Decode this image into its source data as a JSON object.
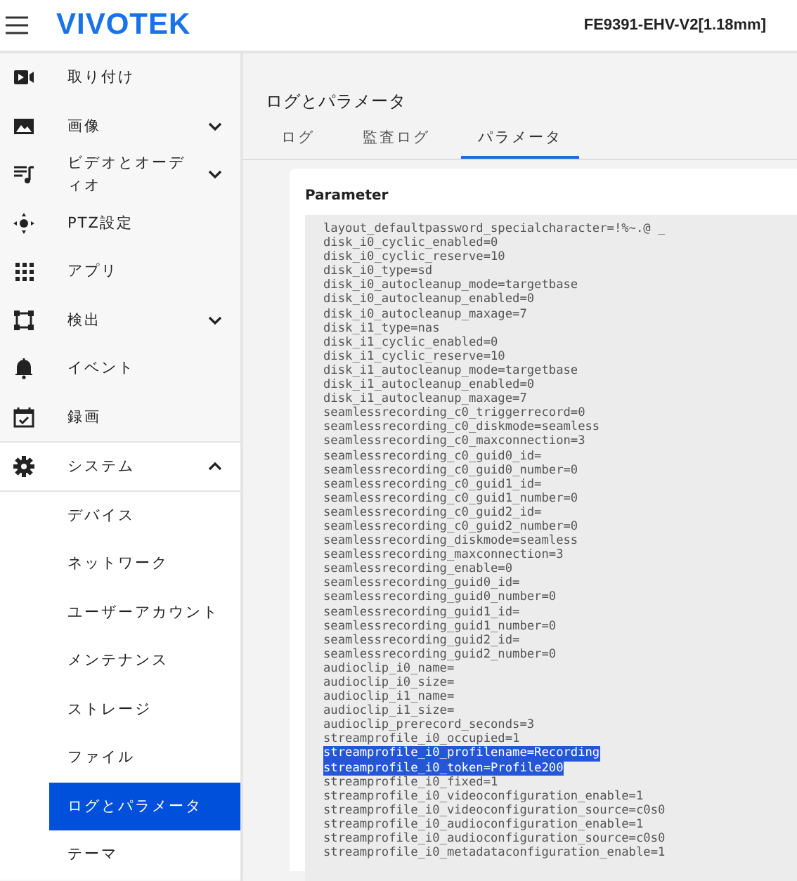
{
  "header": {
    "logo": "VIVOTEK",
    "device": "FE9391-EHV-V2[1.18mm]"
  },
  "sidebar": {
    "items": [
      {
        "label": "取り付け"
      },
      {
        "label": "画像",
        "expanded": false
      },
      {
        "label": "ビデオとオーディオ",
        "expanded": false
      },
      {
        "label": "PTZ設定"
      },
      {
        "label": "アプリ"
      },
      {
        "label": "検出",
        "expanded": false
      },
      {
        "label": "イベント"
      },
      {
        "label": "録画"
      },
      {
        "label": "システム",
        "expanded": true,
        "children": [
          {
            "label": "デバイス",
            "selected": false
          },
          {
            "label": "ネットワーク",
            "selected": false
          },
          {
            "label": "ユーザーアカウント",
            "selected": false
          },
          {
            "label": "メンテナンス",
            "selected": false
          },
          {
            "label": "ストレージ",
            "selected": false
          },
          {
            "label": "ファイル",
            "selected": false
          },
          {
            "label": "ログとパラメータ",
            "selected": true
          },
          {
            "label": "テーマ",
            "selected": false
          }
        ]
      }
    ]
  },
  "page": {
    "title": "ログとパラメータ",
    "tabs": [
      {
        "label": "ログ",
        "selected": false
      },
      {
        "label": "監査ログ",
        "selected": false
      },
      {
        "label": "パラメータ",
        "selected": true
      }
    ],
    "card": {
      "title": "Parameter",
      "lines": [
        {
          "text": "layout_defaultpassword_specialcharacter=!%~.@ _",
          "selected": false
        },
        {
          "text": "disk_i0_cyclic_enabled=0",
          "selected": false
        },
        {
          "text": "disk_i0_cyclic_reserve=10",
          "selected": false
        },
        {
          "text": "disk_i0_type=sd",
          "selected": false
        },
        {
          "text": "disk_i0_autocleanup_mode=targetbase",
          "selected": false
        },
        {
          "text": "disk_i0_autocleanup_enabled=0",
          "selected": false
        },
        {
          "text": "disk_i0_autocleanup_maxage=7",
          "selected": false
        },
        {
          "text": "disk_i1_type=nas",
          "selected": false
        },
        {
          "text": "disk_i1_cyclic_enabled=0",
          "selected": false
        },
        {
          "text": "disk_i1_cyclic_reserve=10",
          "selected": false
        },
        {
          "text": "disk_i1_autocleanup_mode=targetbase",
          "selected": false
        },
        {
          "text": "disk_i1_autocleanup_enabled=0",
          "selected": false
        },
        {
          "text": "disk_i1_autocleanup_maxage=7",
          "selected": false
        },
        {
          "text": "seamlessrecording_c0_triggerrecord=0",
          "selected": false
        },
        {
          "text": "seamlessrecording_c0_diskmode=seamless",
          "selected": false
        },
        {
          "text": "seamlessrecording_c0_maxconnection=3",
          "selected": false
        },
        {
          "text": "seamlessrecording_c0_guid0_id=",
          "selected": false
        },
        {
          "text": "seamlessrecording_c0_guid0_number=0",
          "selected": false
        },
        {
          "text": "seamlessrecording_c0_guid1_id=",
          "selected": false
        },
        {
          "text": "seamlessrecording_c0_guid1_number=0",
          "selected": false
        },
        {
          "text": "seamlessrecording_c0_guid2_id=",
          "selected": false
        },
        {
          "text": "seamlessrecording_c0_guid2_number=0",
          "selected": false
        },
        {
          "text": "seamlessrecording_diskmode=seamless",
          "selected": false
        },
        {
          "text": "seamlessrecording_maxconnection=3",
          "selected": false
        },
        {
          "text": "seamlessrecording_enable=0",
          "selected": false
        },
        {
          "text": "seamlessrecording_guid0_id=",
          "selected": false
        },
        {
          "text": "seamlessrecording_guid0_number=0",
          "selected": false
        },
        {
          "text": "seamlessrecording_guid1_id=",
          "selected": false
        },
        {
          "text": "seamlessrecording_guid1_number=0",
          "selected": false
        },
        {
          "text": "seamlessrecording_guid2_id=",
          "selected": false
        },
        {
          "text": "seamlessrecording_guid2_number=0",
          "selected": false
        },
        {
          "text": "audioclip_i0_name=",
          "selected": false
        },
        {
          "text": "audioclip_i0_size=",
          "selected": false
        },
        {
          "text": "audioclip_i1_name=",
          "selected": false
        },
        {
          "text": "audioclip_i1_size=",
          "selected": false
        },
        {
          "text": "audioclip_prerecord_seconds=3",
          "selected": false
        },
        {
          "text": "streamprofile_i0_occupied=1",
          "selected": false
        },
        {
          "text": "streamprofile_i0_profilename=Recording",
          "selected": true
        },
        {
          "text": "streamprofile_i0_token=Profile200",
          "selected": true
        },
        {
          "text": "streamprofile_i0_fixed=1",
          "selected": false
        },
        {
          "text": "streamprofile_i0_videoconfiguration_enable=1",
          "selected": false
        },
        {
          "text": "streamprofile_i0_videoconfiguration_source=c0s0",
          "selected": false
        },
        {
          "text": "streamprofile_i0_audioconfiguration_enable=1",
          "selected": false
        },
        {
          "text": "streamprofile_i0_audioconfiguration_source=c0s0",
          "selected": false
        },
        {
          "text": "streamprofile_i0_metadataconfiguration_enable=1",
          "selected": false
        }
      ]
    }
  }
}
